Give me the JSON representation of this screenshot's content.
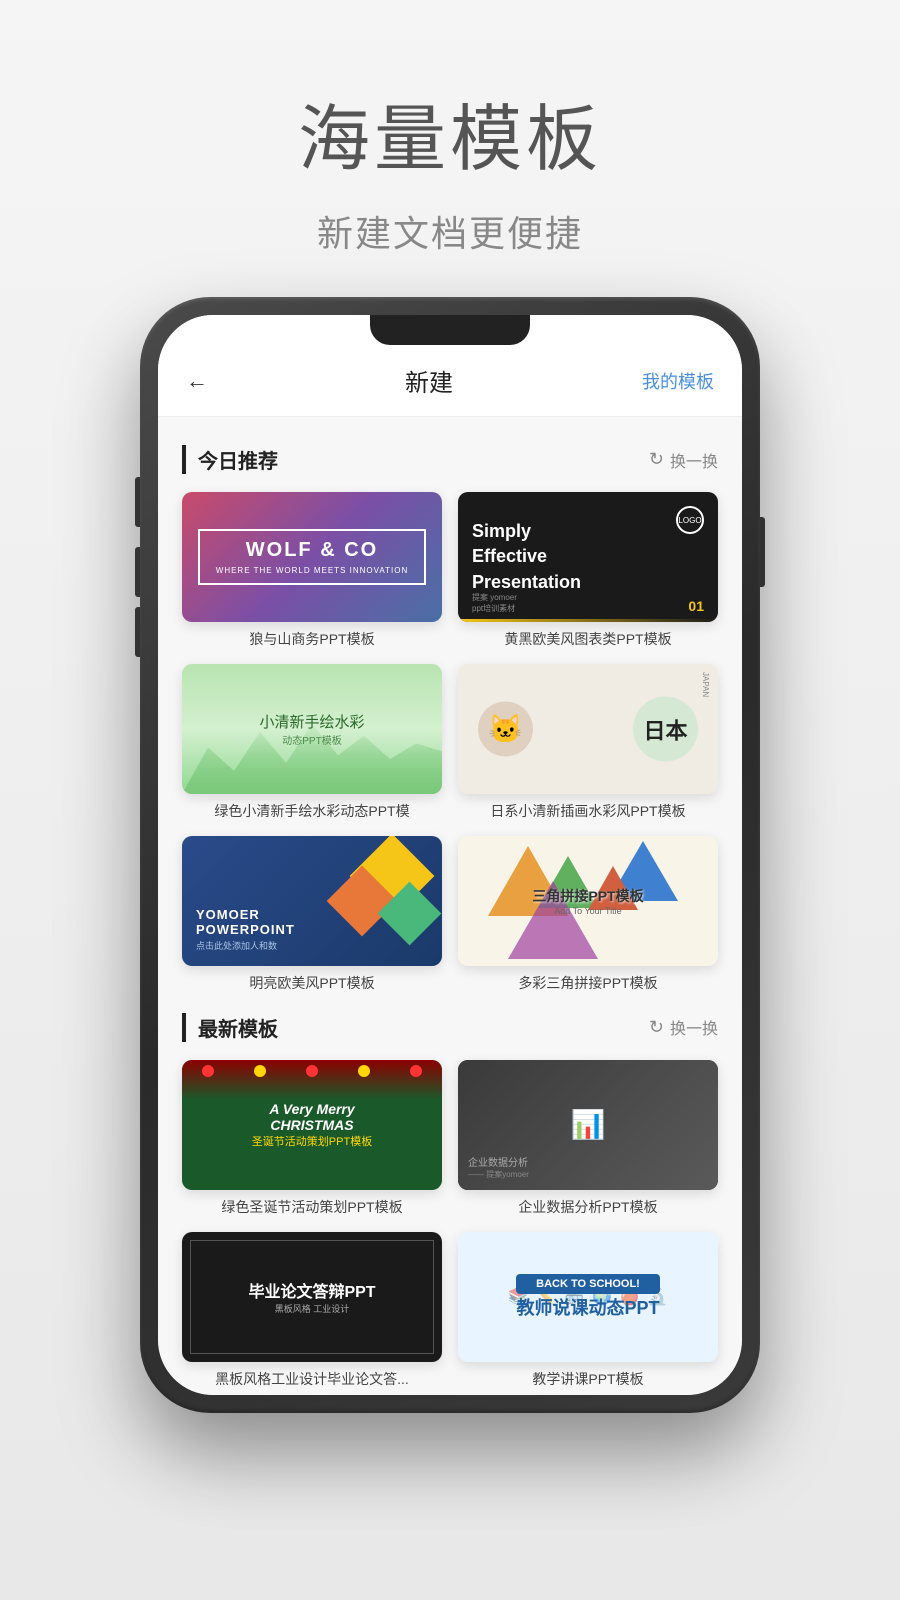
{
  "page": {
    "bg_title_main": "海量模板",
    "bg_title_sub": "新建文档更便捷"
  },
  "app": {
    "header": {
      "back_icon": "←",
      "title": "新建",
      "action": "我的模板"
    },
    "sections": [
      {
        "id": "today",
        "title": "今日推荐",
        "refresh_label": "换一换",
        "templates": [
          {
            "id": "wolf",
            "title_line1": "WOLF & CO",
            "title_line2": "WHERE THE WORLD MEETS INNOVATION",
            "label": "狼与山商务PPT模板",
            "type": "wolf"
          },
          {
            "id": "simply",
            "title": "Simply Effective Presentation",
            "label": "黄黑欧美风图表类PPT模板",
            "logo": "LOGO",
            "number": "01",
            "type": "simply"
          },
          {
            "id": "watercolor",
            "title": "小清新手绘水彩",
            "subtitle": "动态PPT模板",
            "label": "绿色小清新手绘水彩动态PPT模",
            "type": "watercolor"
          },
          {
            "id": "japan",
            "title": "日本",
            "label": "日系小清新插画水彩风PPT模板",
            "type": "japan"
          },
          {
            "id": "yomoer",
            "title": "YOMOER",
            "subtitle": "POWERPOINT",
            "sub2": "点击此处添加人和数",
            "label": "明亮欧美风PPT模板",
            "type": "yomoer"
          },
          {
            "id": "triangle",
            "title": "三角拼接PPT模板",
            "subtitle": "Add To Your Title",
            "label": "多彩三角拼接PPT模板",
            "type": "triangle"
          }
        ]
      },
      {
        "id": "latest",
        "title": "最新模板",
        "refresh_label": "换一换",
        "templates": [
          {
            "id": "christmas",
            "title": "A Very Merry CHRISTMAS",
            "subtitle": "圣诞节活动策划PPT模板",
            "label": "绿色圣诞节活动策划PPT模板",
            "type": "christmas"
          },
          {
            "id": "business",
            "title": "企业数据分析",
            "label": "企业数据分析PPT模板",
            "type": "business"
          },
          {
            "id": "graduation",
            "title": "毕业论文答辩PPT",
            "subtitle": "",
            "label": "黑板风格工业设计毕业论文答...",
            "type": "graduation"
          },
          {
            "id": "teacher",
            "title": "教师说课动态PPT",
            "label": "教学讲课PPT模板",
            "type": "teacher"
          }
        ]
      }
    ]
  }
}
